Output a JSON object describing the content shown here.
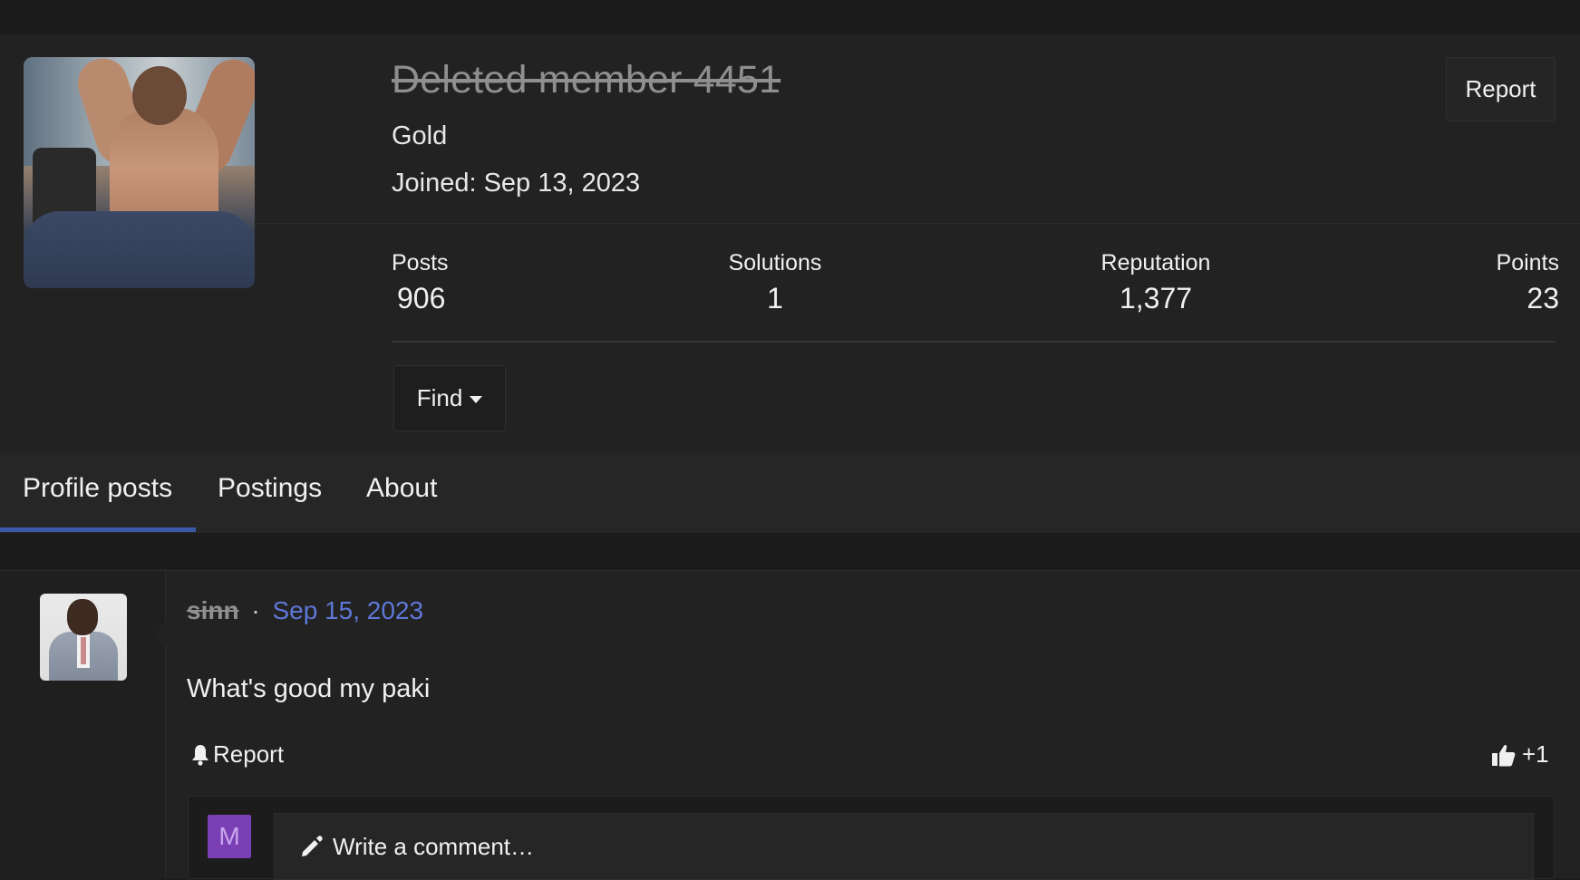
{
  "profile": {
    "username": "Deleted member 4451",
    "rank": "Gold",
    "joined": "Joined: Sep 13, 2023",
    "report_label": "Report",
    "stats": {
      "posts": {
        "label": "Posts",
        "value": "906"
      },
      "solutions": {
        "label": "Solutions",
        "value": "1"
      },
      "reputation": {
        "label": "Reputation",
        "value": "1,377"
      },
      "points": {
        "label": "Points",
        "value": "23"
      }
    },
    "find_label": "Find"
  },
  "tabs": [
    {
      "label": "Profile posts",
      "active": true
    },
    {
      "label": "Postings",
      "active": false
    },
    {
      "label": "About",
      "active": false
    }
  ],
  "post": {
    "author": "sinn",
    "separator": "·",
    "date": "Sep 15, 2023",
    "body": "What's good my paki",
    "report_label": "Report",
    "like_count": "+1",
    "comment_avatar_letter": "M",
    "comment_placeholder": "Write a comment…"
  },
  "colors": {
    "background": "#1c1c1c",
    "panel": "#222222",
    "accent_link": "#5f78d8",
    "tab_underline": "#3a5aa8",
    "comment_avatar": "#7a3fb5"
  },
  "icons": {
    "dropdown": "caret-down-icon",
    "report": "bell-icon",
    "like": "thumbs-up-icon",
    "comment": "pencil-icon"
  }
}
